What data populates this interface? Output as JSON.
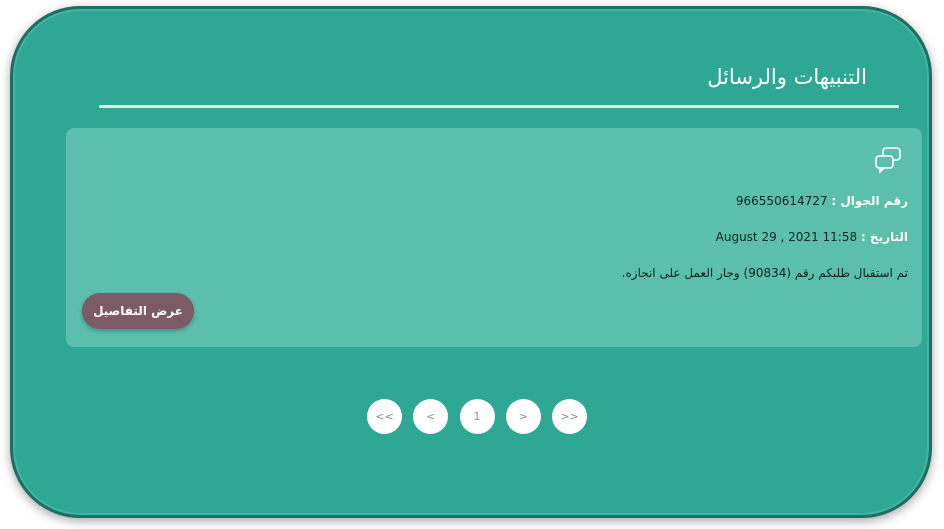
{
  "panel": {
    "title": "التنبيهات والرسائل"
  },
  "message": {
    "icon": "chat-bubbles-icon",
    "phone_label": "رقم الجوال :",
    "phone_value": "966550614727",
    "date_label": "التاريخ :",
    "date_value": "August 29 , 2021 11:58",
    "body": "تم استقبال طلبكم رقم (90834) وجار العمل على انجازه.",
    "details_button": "عرض التفاصيل"
  },
  "pagination": {
    "first": "<<",
    "prev": "<",
    "current": "1",
    "next": ">",
    "last": ">>"
  }
}
